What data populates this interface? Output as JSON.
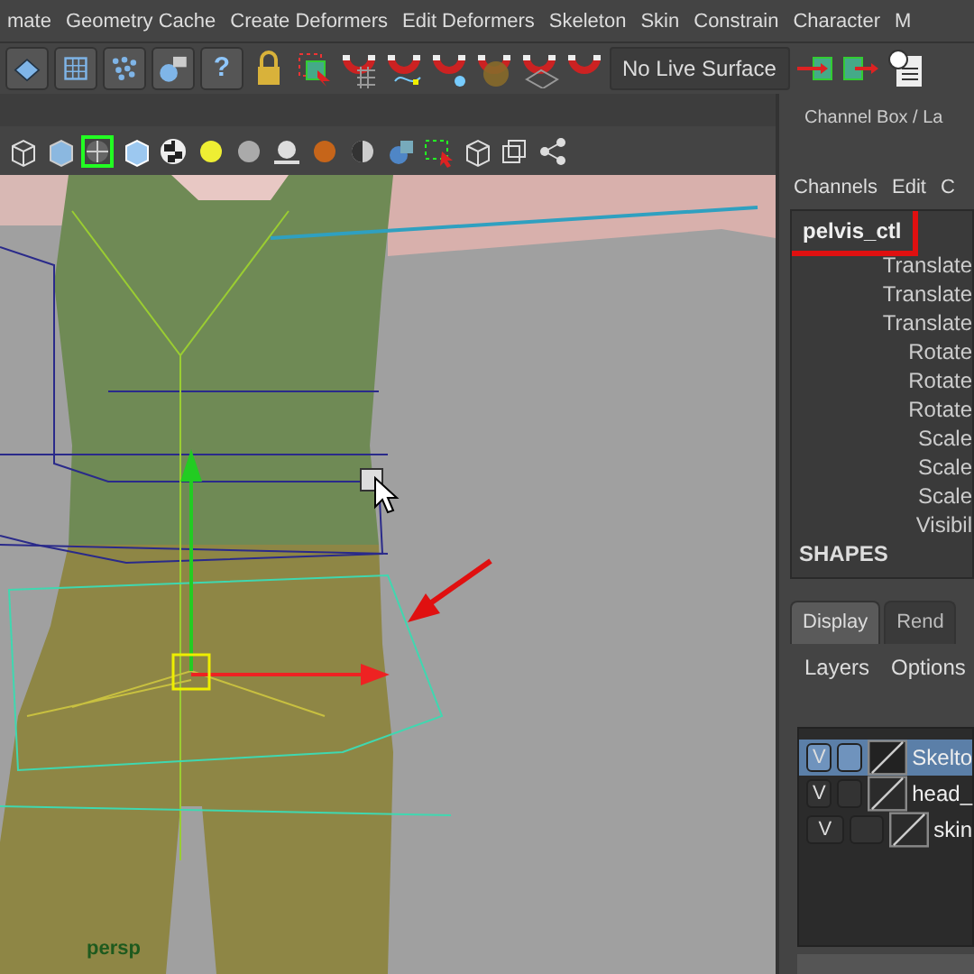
{
  "menu_bar": [
    "mate",
    "Geometry Cache",
    "Create Deformers",
    "Edit Deformers",
    "Skeleton",
    "Skin",
    "Constrain",
    "Character",
    "M"
  ],
  "shelf": {
    "help_label": "?",
    "live_surface": "No Live Surface"
  },
  "viewport": {
    "camera_label": "persp"
  },
  "channel_box": {
    "title": "Channel Box / La",
    "menus": [
      "Channels",
      "Edit",
      "C"
    ],
    "object": "pelvis_ctl",
    "object_annotated": true,
    "attributes": [
      "Translate",
      "Translate",
      "Translate",
      "Rotate",
      "Rotate",
      "Rotate",
      "Scale",
      "Scale",
      "Scale",
      "Visibil"
    ],
    "section": "SHAPES"
  },
  "layer_editor": {
    "tabs": [
      {
        "label": "Display",
        "selected": true
      },
      {
        "label": "Rend",
        "selected": false
      }
    ],
    "menus": [
      "Layers",
      "Options"
    ],
    "layers": [
      {
        "visibility": "V",
        "name": "Skelto",
        "selected": true
      },
      {
        "visibility": "V",
        "name": "head_",
        "selected": false
      },
      {
        "visibility": "V",
        "name": "skin",
        "selected": false
      }
    ]
  }
}
